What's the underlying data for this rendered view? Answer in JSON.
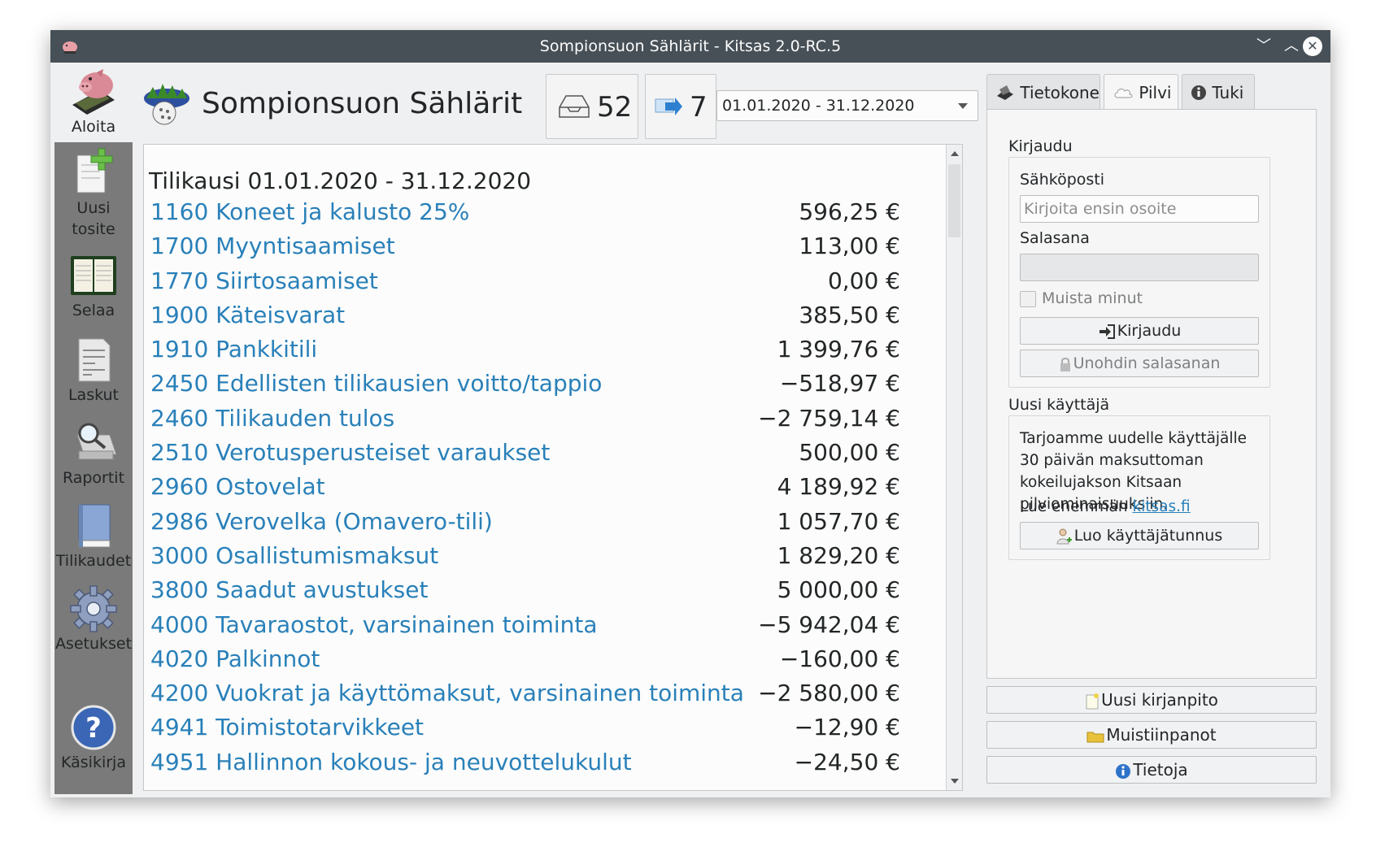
{
  "window": {
    "title": "Sompionsuon Sählärit - Kitsas 2.0-RC.5",
    "minimize_glyph": "﹀",
    "maximize_glyph": "︿",
    "close_glyph": "✕"
  },
  "sidebar": {
    "items": [
      {
        "label": "Aloita",
        "icon": "piggy-bank-icon",
        "active": true
      },
      {
        "label": "Uusi tosite",
        "icon": "new-document-icon"
      },
      {
        "label": "Selaa",
        "icon": "ledger-book-icon"
      },
      {
        "label": "Laskut",
        "icon": "invoice-icon"
      },
      {
        "label": "Raportit",
        "icon": "report-magnifier-icon"
      },
      {
        "label": "Tilikaudet",
        "icon": "book-icon"
      },
      {
        "label": "Asetukset",
        "icon": "gear-icon"
      },
      {
        "label": "Käsikirja",
        "icon": "help-icon"
      }
    ]
  },
  "header": {
    "org_name": "Sompionsuon Sählärit",
    "inbox_count": "52",
    "outbox_count": "7",
    "period_selector": "01.01.2020 - 31.12.2020"
  },
  "main": {
    "period_title": "Tilikausi 01.01.2020 - 31.12.2020",
    "accounts": [
      {
        "name": "1160 Koneet ja kalusto 25%",
        "amount": "596,25 €"
      },
      {
        "name": "1700 Myyntisaamiset",
        "amount": "113,00 €"
      },
      {
        "name": "1770 Siirtosaamiset",
        "amount": "0,00 €"
      },
      {
        "name": "1900 Käteisvarat",
        "amount": "385,50 €"
      },
      {
        "name": "1910 Pankkitili",
        "amount": "1 399,76 €"
      },
      {
        "name": "2450 Edellisten tilikausien voitto/tappio",
        "amount": "−518,97 €"
      },
      {
        "name": "2460 Tilikauden tulos",
        "amount": "−2 759,14 €"
      },
      {
        "name": "2510 Verotusperusteiset varaukset",
        "amount": "500,00 €"
      },
      {
        "name": "2960 Ostovelat",
        "amount": "4 189,92 €"
      },
      {
        "name": "2986 Verovelka (Omavero-tili)",
        "amount": "1 057,70 €"
      },
      {
        "name": "3000 Osallistumismaksut",
        "amount": "1 829,20 €"
      },
      {
        "name": "3800 Saadut avustukset",
        "amount": "5 000,00 €"
      },
      {
        "name": "4000 Tavaraostot, varsinainen toiminta",
        "amount": "−5 942,04 €"
      },
      {
        "name": "4020 Palkinnot",
        "amount": "−160,00 €"
      },
      {
        "name": "4200 Vuokrat ja käyttömaksut, varsinainen toiminta",
        "amount": "−2 580,00 €"
      },
      {
        "name": "4941 Toimistotarvikkeet",
        "amount": "−12,90 €"
      },
      {
        "name": "4951 Hallinnon kokous- ja neuvottelukulut",
        "amount": "−24,50 €"
      }
    ]
  },
  "right": {
    "tabs": [
      {
        "label": "Tietokone",
        "icon": "computer-icon"
      },
      {
        "label": "Pilvi",
        "icon": "cloud-icon",
        "active": true
      },
      {
        "label": "Tuki",
        "icon": "info-icon"
      }
    ],
    "login": {
      "section_title": "Kirjaudu",
      "email_label": "Sähköposti",
      "email_placeholder": "Kirjoita ensin osoite",
      "password_label": "Salasana",
      "remember_label": "Muista minut",
      "login_button": "Kirjaudu",
      "forgot_button": "Unohdin salasanan"
    },
    "new_user": {
      "section_title": "Uusi käyttäjä",
      "description": "Tarjoamme uudelle käyttäjälle 30 päivän maksuttoman kokeilujakson Kitsaan pilviominaisuuksiin.",
      "read_more_prefix": "Lue enemmän",
      "read_more_link": "kitsas.fi",
      "create_button": "Luo käyttäjätunnus"
    },
    "bottom_buttons": {
      "new_books": "Uusi kirjanpito",
      "notes": "Muistiinpanot",
      "about": "Tietoja"
    }
  },
  "colors": {
    "titlebar": "#475057",
    "sidebar": "#7a7a7a",
    "link": "#2980b9",
    "window_bg": "#eff0f1"
  }
}
